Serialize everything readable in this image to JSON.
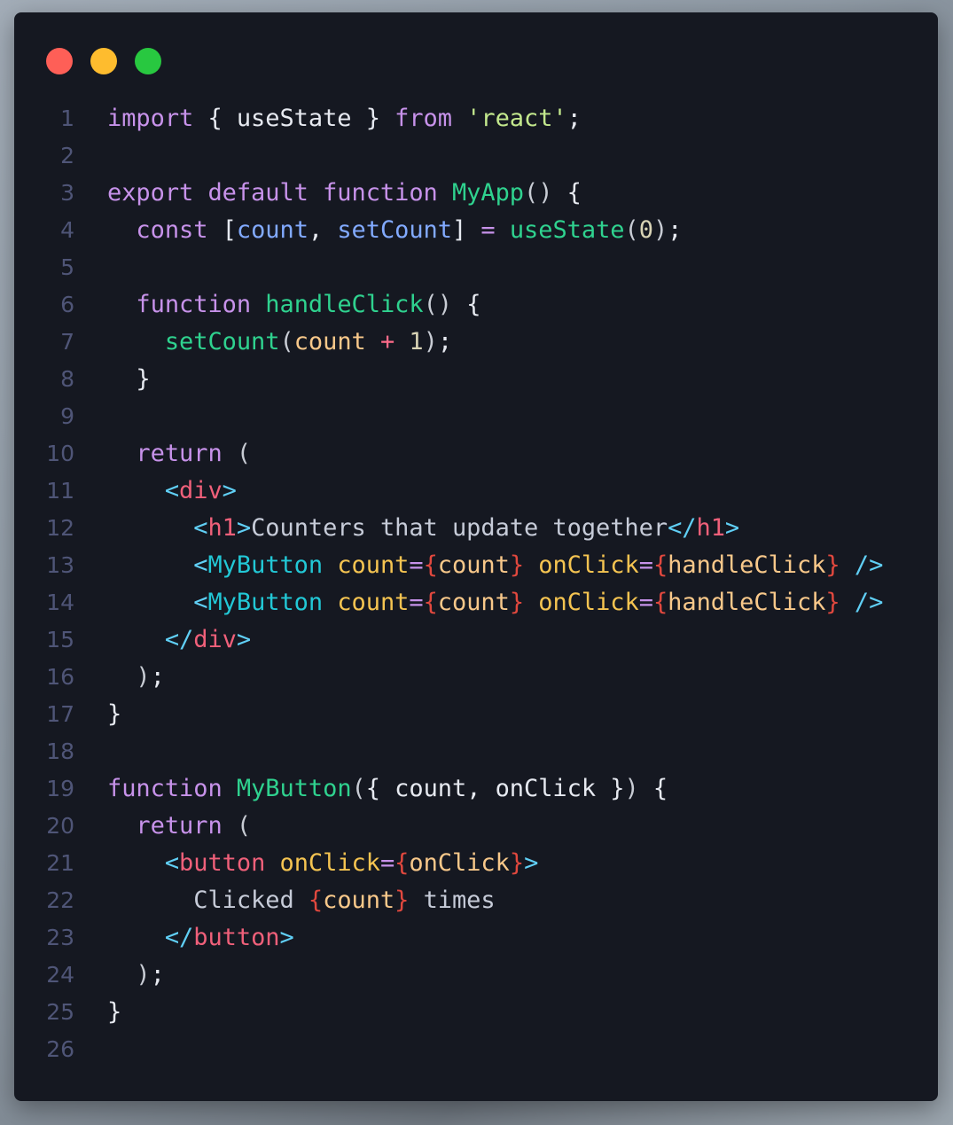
{
  "window": {
    "controls": [
      {
        "name": "close",
        "color": "#fe5f57"
      },
      {
        "name": "minimize",
        "color": "#febc2e"
      },
      {
        "name": "maximize",
        "color": "#28c840"
      }
    ]
  },
  "editor": {
    "language": "jsx",
    "lines": [
      {
        "n": "1",
        "tokens": [
          [
            "kw",
            "import"
          ],
          [
            "plain",
            " { useState } "
          ],
          [
            "kw",
            "from"
          ],
          [
            "plain",
            " "
          ],
          [
            "str",
            "'react'"
          ],
          [
            "plain",
            ";"
          ]
        ]
      },
      {
        "n": "2",
        "tokens": []
      },
      {
        "n": "3",
        "tokens": [
          [
            "kw",
            "export default function"
          ],
          [
            "plain",
            " "
          ],
          [
            "fn",
            "MyApp"
          ],
          [
            "paren",
            "()"
          ],
          [
            "plain",
            " {"
          ]
        ]
      },
      {
        "n": "4",
        "tokens": [
          [
            "plain",
            "  "
          ],
          [
            "kw",
            "const"
          ],
          [
            "plain",
            " ["
          ],
          [
            "var",
            "count"
          ],
          [
            "plain",
            ", "
          ],
          [
            "var",
            "setCount"
          ],
          [
            "plain",
            "] "
          ],
          [
            "op",
            "="
          ],
          [
            "plain",
            " "
          ],
          [
            "fn",
            "useState"
          ],
          [
            "paren",
            "("
          ],
          [
            "num",
            "0"
          ],
          [
            "paren",
            ")"
          ],
          [
            "plain",
            ";"
          ]
        ]
      },
      {
        "n": "5",
        "tokens": []
      },
      {
        "n": "6",
        "tokens": [
          [
            "plain",
            "  "
          ],
          [
            "kw",
            "function"
          ],
          [
            "plain",
            " "
          ],
          [
            "fn",
            "handleClick"
          ],
          [
            "paren",
            "()"
          ],
          [
            "plain",
            " {"
          ]
        ]
      },
      {
        "n": "7",
        "tokens": [
          [
            "plain",
            "    "
          ],
          [
            "fn",
            "setCount"
          ],
          [
            "paren",
            "("
          ],
          [
            "expr",
            "count"
          ],
          [
            "plain",
            " "
          ],
          [
            "plus",
            "+"
          ],
          [
            "plain",
            " "
          ],
          [
            "num",
            "1"
          ],
          [
            "paren",
            ")"
          ],
          [
            "plain",
            ";"
          ]
        ]
      },
      {
        "n": "8",
        "tokens": [
          [
            "plain",
            "  }"
          ]
        ]
      },
      {
        "n": "9",
        "tokens": []
      },
      {
        "n": "10",
        "tokens": [
          [
            "plain",
            "  "
          ],
          [
            "kw",
            "return"
          ],
          [
            "plain",
            " "
          ],
          [
            "paren",
            "("
          ]
        ]
      },
      {
        "n": "11",
        "tokens": [
          [
            "plain",
            "    "
          ],
          [
            "tagb",
            "<"
          ],
          [
            "tag",
            "div"
          ],
          [
            "tagb",
            ">"
          ]
        ]
      },
      {
        "n": "12",
        "tokens": [
          [
            "plain",
            "      "
          ],
          [
            "tagb",
            "<"
          ],
          [
            "tag",
            "h1"
          ],
          [
            "tagb",
            ">"
          ],
          [
            "text",
            "Counters that update together"
          ],
          [
            "tagb",
            "</"
          ],
          [
            "tag",
            "h1"
          ],
          [
            "tagb",
            ">"
          ]
        ]
      },
      {
        "n": "13",
        "tokens": [
          [
            "plain",
            "      "
          ],
          [
            "tagb",
            "<"
          ],
          [
            "comp",
            "MyButton"
          ],
          [
            "plain",
            " "
          ],
          [
            "attr",
            "count"
          ],
          [
            "eq",
            "="
          ],
          [
            "brace",
            "{"
          ],
          [
            "expr",
            "count"
          ],
          [
            "brace",
            "}"
          ],
          [
            "plain",
            " "
          ],
          [
            "attr",
            "onClick"
          ],
          [
            "eq",
            "="
          ],
          [
            "brace",
            "{"
          ],
          [
            "expr",
            "handleClick"
          ],
          [
            "brace",
            "}"
          ],
          [
            "plain",
            " "
          ],
          [
            "tagb",
            "/>"
          ]
        ]
      },
      {
        "n": "14",
        "tokens": [
          [
            "plain",
            "      "
          ],
          [
            "tagb",
            "<"
          ],
          [
            "comp",
            "MyButton"
          ],
          [
            "plain",
            " "
          ],
          [
            "attr",
            "count"
          ],
          [
            "eq",
            "="
          ],
          [
            "brace",
            "{"
          ],
          [
            "expr",
            "count"
          ],
          [
            "brace",
            "}"
          ],
          [
            "plain",
            " "
          ],
          [
            "attr",
            "onClick"
          ],
          [
            "eq",
            "="
          ],
          [
            "brace",
            "{"
          ],
          [
            "expr",
            "handleClick"
          ],
          [
            "brace",
            "}"
          ],
          [
            "plain",
            " "
          ],
          [
            "tagb",
            "/>"
          ]
        ]
      },
      {
        "n": "15",
        "tokens": [
          [
            "plain",
            "    "
          ],
          [
            "tagb",
            "</"
          ],
          [
            "tag",
            "div"
          ],
          [
            "tagb",
            ">"
          ]
        ]
      },
      {
        "n": "16",
        "tokens": [
          [
            "plain",
            "  "
          ],
          [
            "paren",
            ")"
          ],
          [
            "plain",
            ";"
          ]
        ]
      },
      {
        "n": "17",
        "tokens": [
          [
            "plain",
            "}"
          ]
        ]
      },
      {
        "n": "18",
        "tokens": []
      },
      {
        "n": "19",
        "tokens": [
          [
            "kw",
            "function"
          ],
          [
            "plain",
            " "
          ],
          [
            "fn",
            "MyButton"
          ],
          [
            "paren",
            "("
          ],
          [
            "plain",
            "{ count, onClick }"
          ],
          [
            "paren",
            ")"
          ],
          [
            "plain",
            " {"
          ]
        ]
      },
      {
        "n": "20",
        "tokens": [
          [
            "plain",
            "  "
          ],
          [
            "kw",
            "return"
          ],
          [
            "plain",
            " "
          ],
          [
            "paren",
            "("
          ]
        ]
      },
      {
        "n": "21",
        "tokens": [
          [
            "plain",
            "    "
          ],
          [
            "tagb",
            "<"
          ],
          [
            "tag",
            "button"
          ],
          [
            "plain",
            " "
          ],
          [
            "attr",
            "onClick"
          ],
          [
            "eq",
            "="
          ],
          [
            "brace",
            "{"
          ],
          [
            "expr",
            "onClick"
          ],
          [
            "brace",
            "}"
          ],
          [
            "tagb",
            ">"
          ]
        ]
      },
      {
        "n": "22",
        "tokens": [
          [
            "plain",
            "      "
          ],
          [
            "text",
            "Clicked "
          ],
          [
            "brace",
            "{"
          ],
          [
            "expr",
            "count"
          ],
          [
            "brace",
            "}"
          ],
          [
            "text",
            " times"
          ]
        ]
      },
      {
        "n": "23",
        "tokens": [
          [
            "plain",
            "    "
          ],
          [
            "tagb",
            "</"
          ],
          [
            "tag",
            "button"
          ],
          [
            "tagb",
            ">"
          ]
        ]
      },
      {
        "n": "24",
        "tokens": [
          [
            "plain",
            "  "
          ],
          [
            "paren",
            ")"
          ],
          [
            "plain",
            ";"
          ]
        ]
      },
      {
        "n": "25",
        "tokens": [
          [
            "plain",
            "}"
          ]
        ]
      },
      {
        "n": "26",
        "tokens": []
      }
    ]
  }
}
